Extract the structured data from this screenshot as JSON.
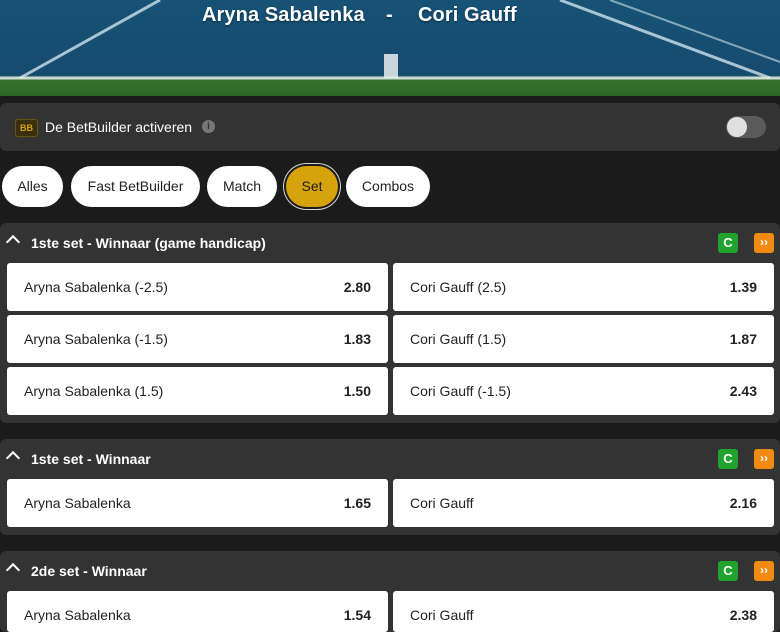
{
  "header": {
    "player1": "Aryna Sabalenka",
    "separator": "-",
    "player2": "Cori Gauff"
  },
  "betbuilder": {
    "badge": "BB",
    "label": "De BetBuilder activeren",
    "info_icon": "info-icon",
    "toggle_on": false
  },
  "tabs": [
    {
      "label": "Alles",
      "active": false
    },
    {
      "label": "Fast BetBuilder",
      "active": false
    },
    {
      "label": "Match",
      "active": false
    },
    {
      "label": "Set",
      "active": true
    },
    {
      "label": "Combos",
      "active": false
    }
  ],
  "markets": [
    {
      "title": "1ste set - Winnaar (game handicap)",
      "rows": [
        {
          "left": {
            "label": "Aryna Sabalenka (-2.5)",
            "odd": "2.80"
          },
          "right": {
            "label": "Cori Gauff (2.5)",
            "odd": "1.39"
          }
        },
        {
          "left": {
            "label": "Aryna Sabalenka (-1.5)",
            "odd": "1.83"
          },
          "right": {
            "label": "Cori Gauff (1.5)",
            "odd": "1.87"
          }
        },
        {
          "left": {
            "label": "Aryna Sabalenka (1.5)",
            "odd": "1.50"
          },
          "right": {
            "label": "Cori Gauff (-1.5)",
            "odd": "2.43"
          }
        }
      ]
    },
    {
      "title": "1ste set - Winnaar",
      "rows": [
        {
          "left": {
            "label": "Aryna Sabalenka",
            "odd": "1.65"
          },
          "right": {
            "label": "Cori Gauff",
            "odd": "2.16"
          }
        }
      ]
    },
    {
      "title": "2de set - Winnaar",
      "rows": [
        {
          "left": {
            "label": "Aryna Sabalenka",
            "odd": "1.54"
          },
          "right": {
            "label": "Cori Gauff",
            "odd": "2.38"
          }
        }
      ]
    }
  ],
  "icons": {
    "cashout": "cashout-icon",
    "boost": "boost-icon",
    "collapse": "chevron-up-icon"
  },
  "colors": {
    "accent": "#d6a30d",
    "cashout": "#1fa32e",
    "boost": "#f08a12",
    "panel": "#333333",
    "background": "#1b1b1b"
  }
}
